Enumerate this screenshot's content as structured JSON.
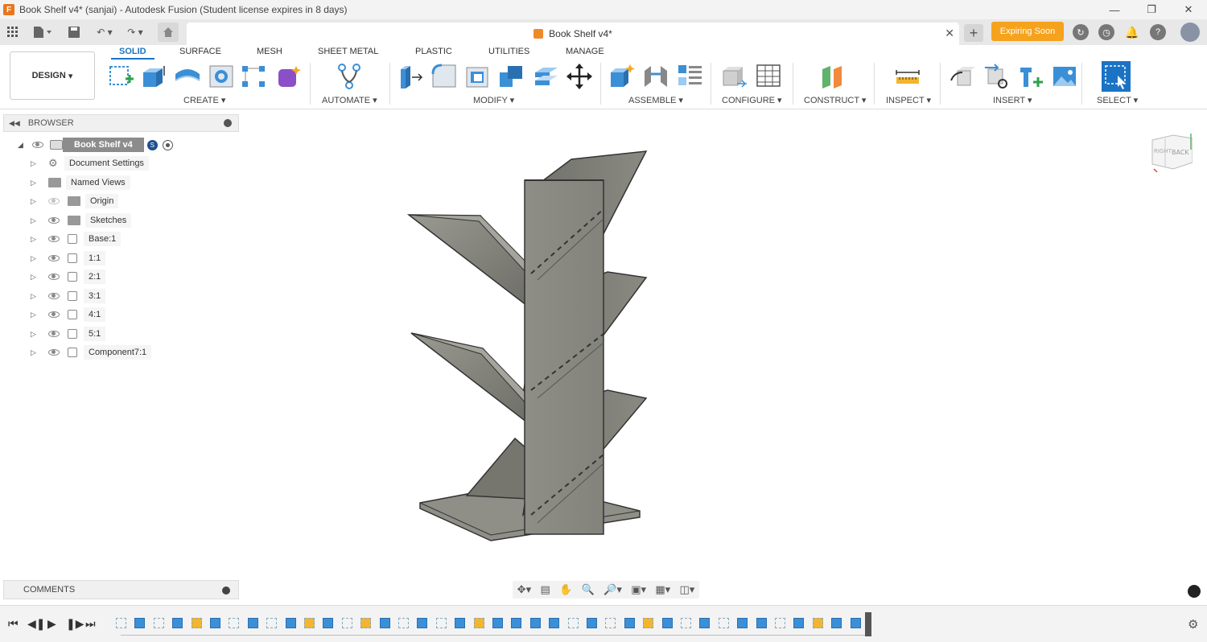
{
  "window": {
    "title": "Book Shelf v4* (sanjai) - Autodesk Fusion (Student license expires in 8 days)",
    "logo_letter": "F"
  },
  "tabs": {
    "doc_title": "Book Shelf v4*",
    "expiring": "Expiring Soon"
  },
  "ribbon": {
    "workspace": "DESIGN",
    "tabs": [
      "SOLID",
      "SURFACE",
      "MESH",
      "SHEET METAL",
      "PLASTIC",
      "UTILITIES",
      "MANAGE"
    ],
    "groups": [
      "CREATE",
      "AUTOMATE",
      "MODIFY",
      "ASSEMBLE",
      "CONFIGURE",
      "CONSTRUCT",
      "INSPECT",
      "INSERT",
      "SELECT"
    ]
  },
  "browser": {
    "title": "BROWSER",
    "root": "Book Shelf v4",
    "items": [
      "Document Settings",
      "Named Views",
      "Origin",
      "Sketches",
      "Base:1",
      "1:1",
      "2:1",
      "3:1",
      "4:1",
      "5:1",
      "Component7:1"
    ]
  },
  "comments": {
    "title": "COMMENTS"
  },
  "viewcube": {
    "left": "RIGHT",
    "right": "BACK"
  },
  "colors": {
    "accent": "#1a73c4",
    "expiring": "#f5a21c",
    "model": "#7d7d76"
  }
}
